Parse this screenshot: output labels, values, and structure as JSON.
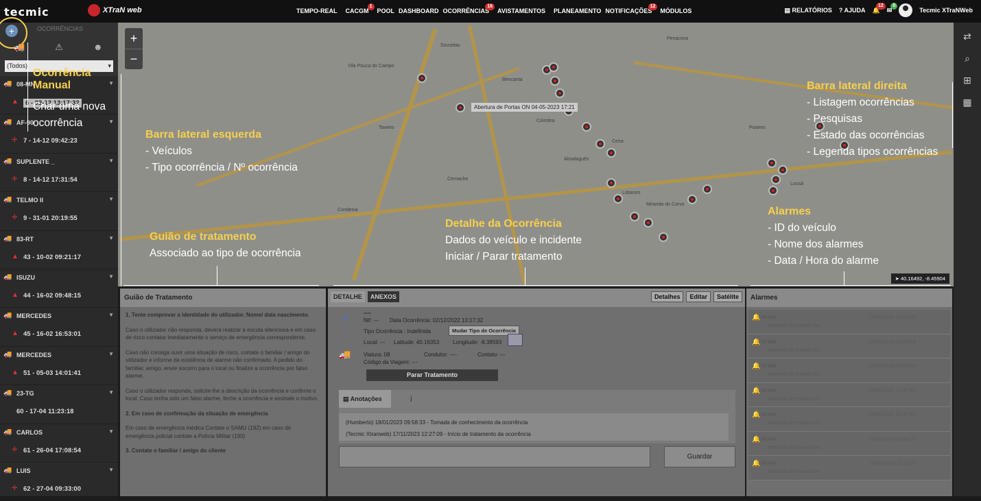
{
  "topbar": {
    "logo_left": "tecmic",
    "logo_right": "XTraN web",
    "nav": [
      {
        "label": "TEMPO-REAL",
        "badge": ""
      },
      {
        "label": "CACGM",
        "badge": "1"
      },
      {
        "label": "POOL",
        "badge": ""
      },
      {
        "label": "DASHBOARD",
        "badge": ""
      },
      {
        "label": "OCORRÊNCIAS",
        "badge": "16"
      },
      {
        "label": "AVISTAMENTOS",
        "badge": ""
      },
      {
        "label": "PLANEAMENTO",
        "badge": ""
      },
      {
        "label": "NOTIFICAÇÕES",
        "badge": "12"
      },
      {
        "label": "MÓDULOS",
        "badge": ""
      }
    ],
    "relatorios": "RELATÓRIOS",
    "ajuda": "AJUDA",
    "bell_badge": "12",
    "mail_badge": "0",
    "user": "Tecmic XTraNWeb"
  },
  "left": {
    "title": "OCORRÊNCIAS",
    "filter": "(Todos)",
    "vehicles": [
      {
        "name": "08-MN",
        "occ": "6 - 02-12 13:17:32"
      },
      {
        "name": "AF-90",
        "occ": "7 - 14-12 09:42:23"
      },
      {
        "name": "SUPLENTE _",
        "occ": "8 - 14-12 17:31:54"
      },
      {
        "name": "TELMO II",
        "occ": "9 - 31-01 20:19:55"
      },
      {
        "name": "83-RT",
        "occ": "43 - 10-02 09:21:17"
      },
      {
        "name": "ISUZU",
        "occ": "44 - 16-02 09:48:15"
      },
      {
        "name": "MERCEDES",
        "occ": "45 - 16-02 16:53:01"
      },
      {
        "name": "MERCEDES",
        "occ": "51 - 05-03 14:01:41"
      },
      {
        "name": "23-TG",
        "occ": "60 - 17-04 11:23:18"
      },
      {
        "name": "CARLOS",
        "occ": "61 - 26-04 17:08:54"
      },
      {
        "name": "LUIS",
        "occ": "62 - 27-04 09:33:00"
      }
    ]
  },
  "map": {
    "tooltip": "Abertura de Portas ON  04-05-2023 17:21",
    "coords": "40.16492, -8.45904",
    "towns": [
      "Vila Pouca do Campo",
      "Bencanta",
      "Coimbra",
      "Almalaguês",
      "Lobases",
      "Miranda do Corvo",
      "Penacova",
      "Souselas",
      "Taveiro",
      "Cernache",
      "Condeixa",
      "Lousã",
      "Poiares",
      "Ceira"
    ]
  },
  "guide": {
    "title": "Guião de Tratamento",
    "paras": [
      "1. Tente comprovar a identidade do utilizador. Nome/ data nascimento.",
      "Caso o utilizador não responda, deverá realizar a escuta silenciosa e em caso de risco contatar imediatamente o serviço de emergência correspondente.",
      "Caso não consiga ouvir uma situação de risco, contate o familiar / amigo do utilizador e informe da existência de alarme não confirmado. A pedido do familiar, amigo, envie socorro para o local ou finalize a ocorrência por falso alarme.",
      "Caso o utilizador responda, solicite-lhe a descrição da ocorrência e confirme o local. Caso tenha sido um falso alarme, feche a ocorrência e assinale o motivo.",
      "2. Em caso de confirmação da situação de emergência",
      "Em caso de emergência médica Contate o SAMU (192) em caso de emergência policial contate a Polícia Militar (190)",
      "3. Contate o familiar / amigo do cliente"
    ]
  },
  "detail": {
    "tab_detail": "DETALHE",
    "tab_attach": "ANEXOS",
    "btn_details": "Detalhes",
    "btn_edit": "Editar",
    "btn_sat": "Satélite",
    "dash": "----",
    "nif": "Nif:  ---",
    "data_occ": "Data Ocorrência:  02/12/2022 13:17:32",
    "tipo": "Tipo Ocorrência :  Indefinida",
    "mudar": "Mudar Tipo de Ocorrência",
    "local": "Local:  ---",
    "latitude": "Latitude:  40.16353",
    "longitude": "Longitude:  -8.38593",
    "viatura": "Viatura:  08",
    "condutor": "Condutor:  ----",
    "contato": "Contato:  ---",
    "codigo": "Código da Viagem:  ---",
    "stop": "Parar Tratamento",
    "notes_tab": "Anotações",
    "log": [
      "(Humberto)        18/01/2023 09:58:33 - Tomada de conhecimento da ocorrência",
      "(Tecmic Xtranweb)  17/11/2023 12:27:09 - Início de tratamento da ocorrência"
    ],
    "save": "Guardar"
  },
  "alarms": {
    "title": "Alarmes",
    "items": [
      {
        "name": "08-MN",
        "date": "15/06/2023 09:53:22",
        "label": "Abertura de Portas On"
      },
      {
        "name": "08-MN",
        "date": "15/06/2023 09:49:16",
        "label": "Abertura de Portas On"
      },
      {
        "name": "08-MN",
        "date": "15/06/2023 09:55:45",
        "label": "Abertura de Portas On"
      },
      {
        "name": "08-MN",
        "date": "15/06/2023 10:47:29",
        "label": "Abertura de Portas On"
      },
      {
        "name": "08-MN",
        "date": "15/06/2023 09:47:30",
        "label": "Abertura de Portas On"
      },
      {
        "name": "08-MN",
        "date": "15/06/2023 10:49:25",
        "label": "Abertura de Portas On"
      },
      {
        "name": "08-MN",
        "date": "15/06/2023 11:11:23",
        "label": "Abertura de Portas On"
      }
    ]
  },
  "annotations": {
    "manual_title": "Ocorrência Manual",
    "manual_lines": [
      "Criar uma nova",
      "ocorrência"
    ],
    "left_title": "Barra lateral esquerda",
    "left_lines": [
      "- Veículos",
      "- Tipo ocorrência / Nº ocorrência"
    ],
    "guide_title": "Guião de tratamento",
    "guide_lines": [
      "Associado ao tipo de ocorrência"
    ],
    "detail_title": "Detalhe da Ocorrência",
    "detail_lines": [
      "Dados do veículo e incidente",
      "Iniciar / Parar tratamento"
    ],
    "right_title": "Barra lateral direita",
    "right_lines": [
      "- Listagem ocorrências",
      "- Pesquisas",
      "- Estado das ocorrências",
      "- Legenda tipos ocorrências"
    ],
    "alarm_title": "Alarmes",
    "alarm_lines": [
      "- ID do veículo",
      "- Nome dos alarmes",
      "- Data / Hora do alarme"
    ]
  }
}
